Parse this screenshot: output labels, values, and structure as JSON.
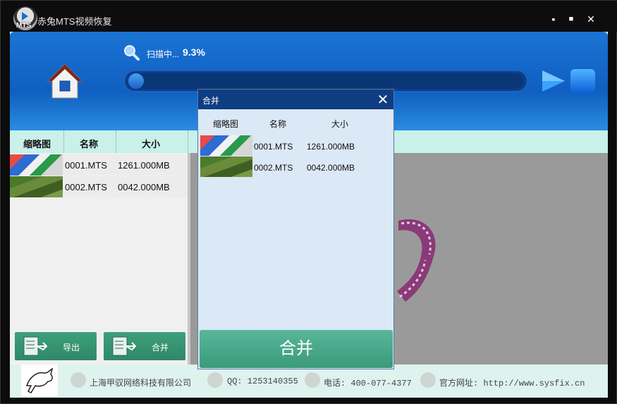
{
  "window": {
    "title": "赤兔MTS视频恢复",
    "logo_text": "MTS",
    "minimize_glyph": "▪",
    "maximize_glyph": "■",
    "close_glyph": "✕"
  },
  "scan": {
    "label": "扫描中...",
    "percent_text": "9.3%",
    "progress": 0.093
  },
  "table": {
    "headers": [
      "缩略图",
      "名称",
      "大小"
    ],
    "rows": [
      {
        "name": "0001.MTS",
        "size": "1261.000MB"
      },
      {
        "name": "0002.MTS",
        "size": "0042.000MB"
      }
    ]
  },
  "actions": {
    "export_label": "导出",
    "merge_label": "合并"
  },
  "footer": {
    "company": "上海甲驭网络科技有限公司",
    "qq": "QQ: 1253140355",
    "phone": "电话: 400-077-4377",
    "website": "官方网址: http://www.sysfix.cn"
  },
  "dialog": {
    "title": "合并",
    "close_glyph": "✕",
    "headers": [
      "缩略图",
      "名称",
      "大小"
    ],
    "rows": [
      {
        "name": "0001.MTS",
        "size": "1261.000MB"
      },
      {
        "name": "0002.MTS",
        "size": "0042.000MB"
      }
    ],
    "button_label": "合并"
  },
  "icons": [
    "app-logo-icon",
    "home-icon",
    "search-icon",
    "play-icon",
    "stop-icon",
    "film-reel-icon",
    "export-icon",
    "merge-icon",
    "building-icon",
    "qq-icon",
    "phone-icon",
    "globe-icon",
    "horse-logo-icon",
    "close-icon"
  ],
  "colors": {
    "accent_blue": "#1b74d4",
    "header_teal": "#c9f0e9",
    "button_green": "#3da07d",
    "dialog_title": "#0f3d82"
  }
}
